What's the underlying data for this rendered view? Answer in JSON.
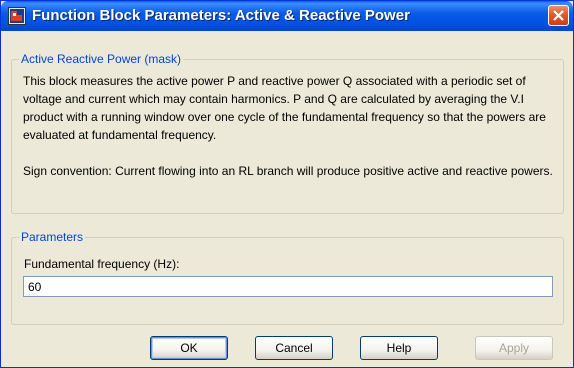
{
  "window": {
    "title": "Function Block Parameters: Active & Reactive Power"
  },
  "mask_group": {
    "legend": "Active  Reactive Power (mask)",
    "paragraphs": [
      "This block measures the active power P and reactive power Q  associated with a periodic  set of voltage and current which may contain harmonics. P and Q are calculated by averaging the V.I product with a running window over one cycle of the fundamental frequency so that the powers are evaluated at fundamental frequency.",
      "Sign convention: Current flowing into an RL branch will produce positive active and reactive powers."
    ]
  },
  "parameters_group": {
    "legend": "Parameters",
    "fundamental_frequency": {
      "label": "Fundamental frequency (Hz):",
      "value": "60"
    }
  },
  "buttons": {
    "ok": "OK",
    "cancel": "Cancel",
    "help": "Help",
    "apply": "Apply"
  },
  "icons": {
    "title_icon": "simulink-block-icon",
    "close_icon": "close-icon"
  },
  "colors": {
    "titlebar": "#0054E3",
    "group_legend": "#0046D5",
    "close_button": "#E2582C"
  }
}
